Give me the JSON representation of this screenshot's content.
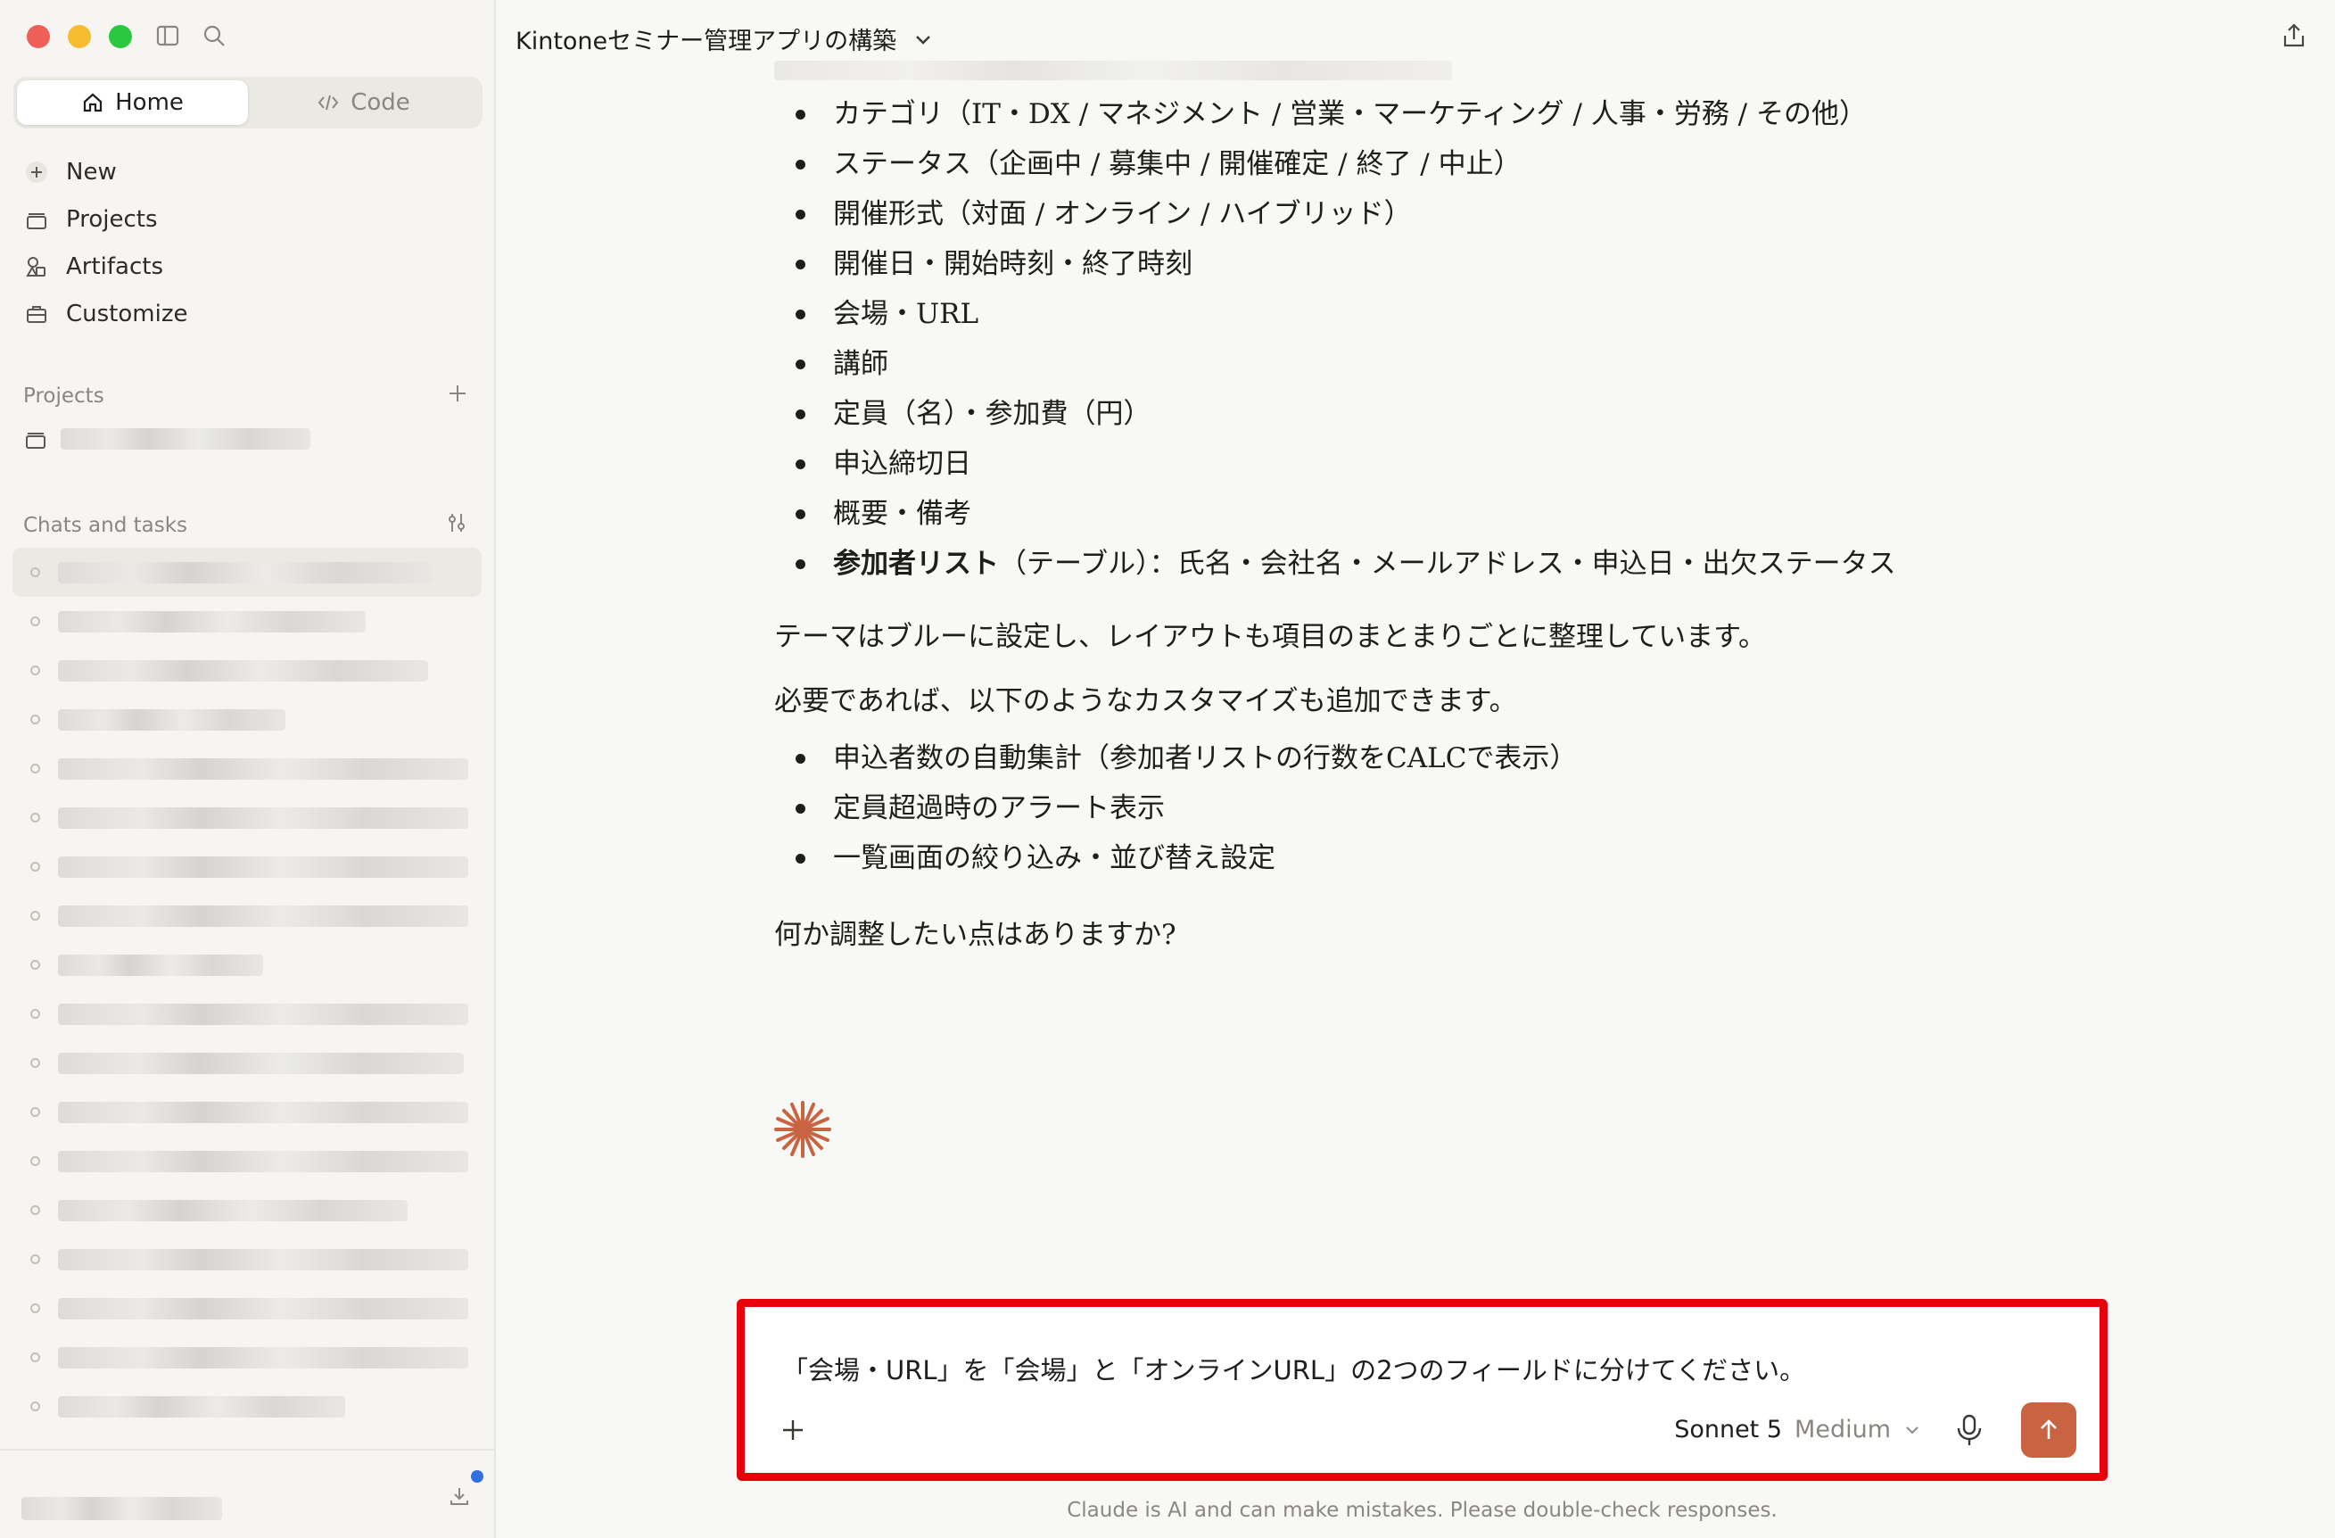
{
  "sidebar": {
    "tabs": {
      "home": "Home",
      "code": "Code"
    },
    "nav": {
      "new": "New",
      "projects": "Projects",
      "artifacts": "Artifacts",
      "customize": "Customize"
    },
    "projects_heading": "Projects",
    "chats_heading": "Chats and tasks"
  },
  "header": {
    "title": "Kintoneセミナー管理アプリの構築"
  },
  "message": {
    "fields": [
      "カテゴリ（IT・DX / マネジメント / 営業・マーケティング / 人事・労務 / その他）",
      "ステータス（企画中 / 募集中 / 開催確定 / 終了 / 中止）",
      "開催形式（対面 / オンライン / ハイブリッド）",
      "開催日・開始時刻・終了時刻",
      "会場・URL",
      "講師",
      "定員（名）・参加費（円）",
      "申込締切日",
      "概要・備考"
    ],
    "table_field_bold": "参加者リスト",
    "table_field_rest": "（テーブル）：氏名・会社名・メールアドレス・申込日・出欠ステータス",
    "theme_note": "テーマはブルーに設定し、レイアウトも項目のまとまりごとに整理しています。",
    "customize_intro": "必要であれば、以下のようなカスタマイズも追加できます。",
    "customizations": [
      "申込者数の自動集計（参加者リストの行数をCALCで表示）",
      "定員超過時のアラート表示",
      "一覧画面の絞り込み・並び替え設定"
    ],
    "question": "何か調整したい点はありますか?"
  },
  "composer": {
    "text": "「会場・URL」を「会場」と「オンラインURL」の2つのフィールドに分けてください。",
    "model": "Sonnet 5",
    "effort": "Medium"
  },
  "disclaimer": "Claude is AI and can make mistakes. Please double-check responses.",
  "colors": {
    "accent": "#c96442",
    "highlight_border": "#e8000a",
    "notification": "#2f6fe0"
  }
}
